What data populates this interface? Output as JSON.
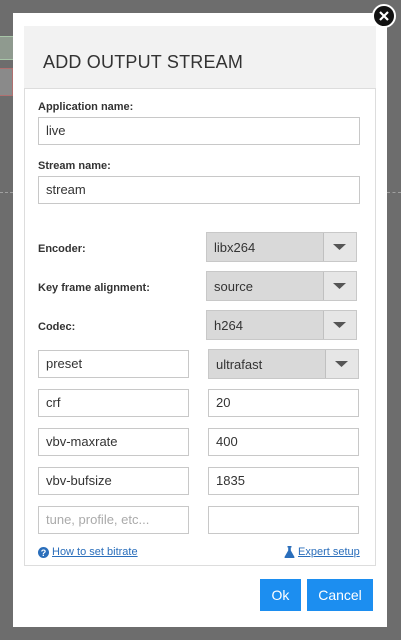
{
  "modal": {
    "title": "ADD OUTPUT STREAM"
  },
  "fields": {
    "app_label": "Application name:",
    "app_value": "live",
    "stream_label": "Stream name:",
    "stream_value": "stream",
    "encoder_label": "Encoder:",
    "encoder_value": "libx264",
    "keyframe_label": "Key frame alignment:",
    "keyframe_value": "source",
    "codec_label": "Codec:",
    "codec_value": "h264"
  },
  "params": [
    {
      "key": "preset",
      "value": "ultrafast"
    },
    {
      "key": "crf",
      "value": "20"
    },
    {
      "key": "vbv-maxrate",
      "value": "400"
    },
    {
      "key": "vbv-bufsize",
      "value": "1835"
    }
  ],
  "new_param": {
    "key_placeholder": "tune, profile, etc...",
    "value": ""
  },
  "links": {
    "bitrate_help": "How to set bitrate",
    "expert_setup": "Expert setup"
  },
  "buttons": {
    "ok": "Ok",
    "cancel": "Cancel"
  },
  "colors": {
    "primary": "#1c8ef0",
    "link": "#2a6ebb",
    "overlay": "#6d6d6d"
  }
}
